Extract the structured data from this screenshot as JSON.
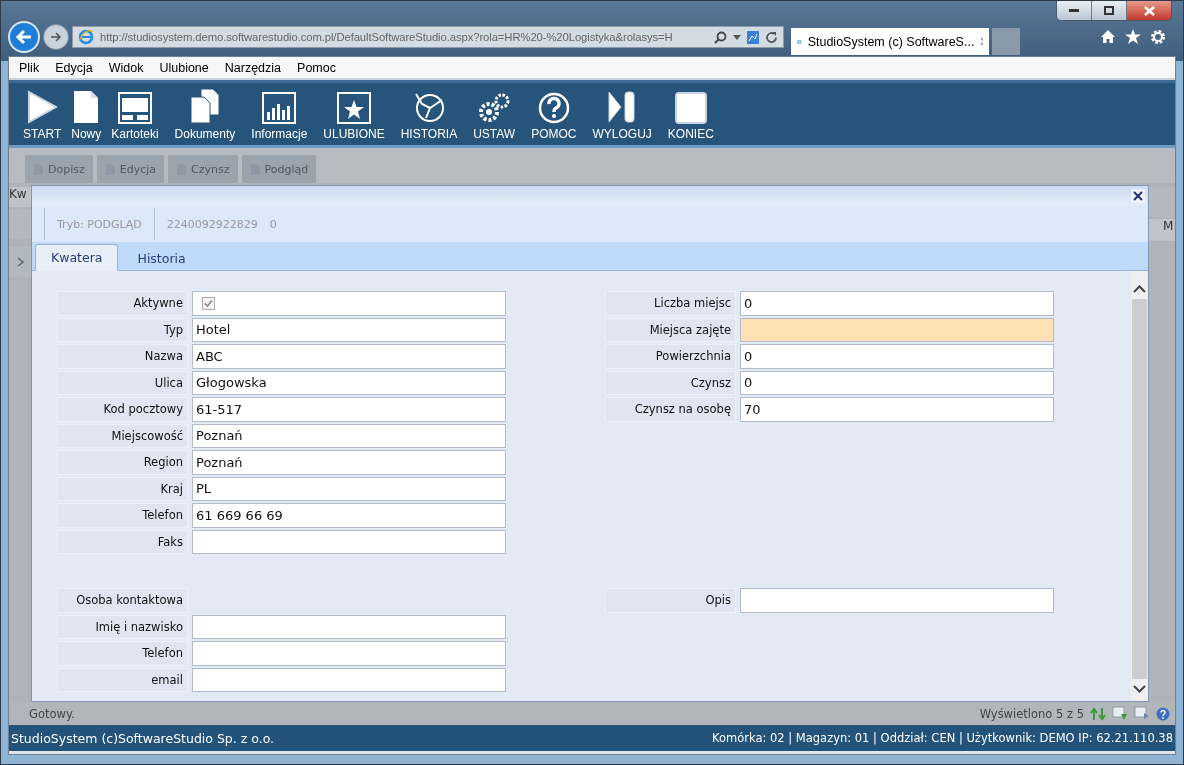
{
  "browser": {
    "url": "http://studiosystem.demo.softwarestudio.com.pl/DefaultSoftwareStudio.aspx?rola=HR%20-%20Logistyka&rolasys=H",
    "tab_title": "StudioSystem (c) SoftwareS..."
  },
  "menu": [
    "Plik",
    "Edycja",
    "Widok",
    "Ulubione",
    "Narzędzia",
    "Pomoc"
  ],
  "toolbar": [
    {
      "label": "START"
    },
    {
      "label": "Nowy"
    },
    {
      "label": "Kartoteki"
    },
    {
      "label": "Dokumenty"
    },
    {
      "label": "Informacje"
    },
    {
      "label": "ULUBIONE"
    },
    {
      "label": "HISTORIA"
    },
    {
      "label": "USTAW"
    },
    {
      "label": "POMOC"
    },
    {
      "label": "WYLOGUJ"
    },
    {
      "label": "KONIEC"
    }
  ],
  "subtoolbar": [
    {
      "label": "Dopisz",
      "disabled": true
    },
    {
      "label": "Edycja",
      "disabled": true
    },
    {
      "label": "Czynsz",
      "disabled": true
    },
    {
      "label": "Podgląd",
      "disabled": true
    }
  ],
  "grid": {
    "column_1": "Kw",
    "column_2": "M"
  },
  "dialog": {
    "mode": "Tryb: PODGLĄD",
    "record_id": "2240092922829",
    "record_value": "0",
    "tabs": [
      {
        "label": "Kwatera",
        "selected": true
      },
      {
        "label": "Historia",
        "selected": false
      }
    ],
    "left_fields": [
      {
        "kind": "checkbox",
        "label": "Aktywne",
        "checked": true
      },
      {
        "kind": "text",
        "label": "Typ",
        "value": "Hotel"
      },
      {
        "kind": "text",
        "label": "Nazwa",
        "value": "ABC"
      },
      {
        "kind": "text",
        "label": "Ulica",
        "value": "Głogowska"
      },
      {
        "kind": "text",
        "label": "Kod pocztowy",
        "value": "61-517"
      },
      {
        "kind": "text",
        "label": "Miejscowość",
        "value": "Poznań"
      },
      {
        "kind": "text",
        "label": "Region",
        "value": "Poznań"
      },
      {
        "kind": "text",
        "label": "Kraj",
        "value": "PL"
      },
      {
        "kind": "text",
        "label": "Telefon",
        "value": "61 669 66 69"
      },
      {
        "kind": "text",
        "label": "Faks"
      }
    ],
    "right_fields": [
      {
        "kind": "text",
        "label": "Liczba miejsc",
        "value": "0",
        "highlighted": false
      },
      {
        "kind": "text",
        "label": "Miejsca zajęte",
        "highlighted": true
      },
      {
        "kind": "text",
        "label": "Powierzchnia",
        "value": "0",
        "highlighted": false
      },
      {
        "kind": "text",
        "label": "Czynsz",
        "value": "0",
        "highlighted": false
      },
      {
        "kind": "text",
        "label": "Czynsz na osobę",
        "value": "70",
        "highlighted": false
      }
    ],
    "contact_fields": [
      {
        "kind": "heading",
        "label": "Osoba kontaktowa"
      },
      {
        "kind": "text",
        "label": "Imię i nazwisko"
      },
      {
        "kind": "text",
        "label": "Telefon"
      },
      {
        "kind": "text",
        "label": "email"
      }
    ],
    "description_field": {
      "label": "Opis"
    }
  },
  "status": {
    "text": "Gotowy.",
    "records": "Wyświetlono 5 z 5"
  },
  "footer": {
    "left": "StudioSystem (c)SoftwareStudio Sp. z o.o.",
    "right": "Komórka: 02 | Magazyn: 01 | Oddział: CEN | Użytkownik: DEMO IP: 62.21.110.38"
  }
}
